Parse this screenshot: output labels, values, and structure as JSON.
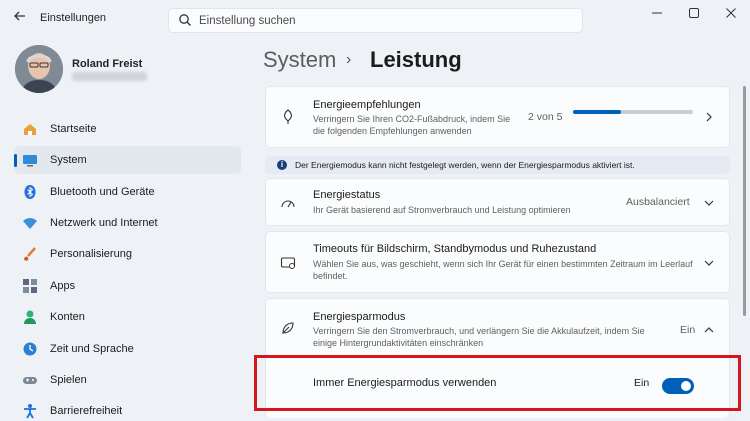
{
  "window": {
    "title": "Einstellungen"
  },
  "search": {
    "placeholder": "Einstellung suchen"
  },
  "profile": {
    "name": "Roland Freist"
  },
  "sidebar": {
    "items": [
      {
        "label": "Startseite",
        "icon": "home-icon",
        "active": false
      },
      {
        "label": "System",
        "icon": "system-monitor-icon",
        "active": true
      },
      {
        "label": "Bluetooth und Geräte",
        "icon": "bluetooth-icon",
        "active": false
      },
      {
        "label": "Netzwerk und Internet",
        "icon": "wifi-icon",
        "active": false
      },
      {
        "label": "Personalisierung",
        "icon": "brush-icon",
        "active": false
      },
      {
        "label": "Apps",
        "icon": "apps-icon",
        "active": false
      },
      {
        "label": "Konten",
        "icon": "account-icon",
        "active": false
      },
      {
        "label": "Zeit und Sprache",
        "icon": "clock-globe-icon",
        "active": false
      },
      {
        "label": "Spielen",
        "icon": "gamepad-icon",
        "active": false
      },
      {
        "label": "Barrierefreiheit",
        "icon": "accessibility-icon",
        "active": false
      }
    ]
  },
  "breadcrumb": {
    "parent": "System",
    "separator": "›",
    "current": "Leistung"
  },
  "energy_recommendations": {
    "title": "Energieempfehlungen",
    "description": "Verringern Sie Ihren CO2-Fußabdruck, indem Sie die folgenden Empfehlungen anwenden",
    "progress_text": "2 von 5",
    "progress_fraction": 0.4
  },
  "info": {
    "text": "Der Energiemodus kann nicht festgelegt werden, wenn der Energiesparmodus aktiviert ist."
  },
  "energy_status": {
    "title": "Energiestatus",
    "description": "Ihr Gerät basierend auf Stromverbrauch und Leistung optimieren",
    "value": "Ausbalanciert"
  },
  "timeouts": {
    "title": "Timeouts für Bildschirm, Standbymodus und Ruhezustand",
    "description": "Wählen Sie aus, was geschieht, wenn sich Ihr Gerät für einen bestimmten Zeitraum im Leerlauf befindet."
  },
  "energy_saver": {
    "title": "Energiesparmodus",
    "description": "Verringern Sie den Stromverbrauch, und verlängern Sie die Akkulaufzeit, indem Sie einige Hintergrundaktivitäten einschränken",
    "value": "Ein"
  },
  "always_saver": {
    "label": "Immer Energiesparmodus verwenden",
    "state_text": "Ein",
    "enabled": true
  },
  "colors": {
    "accent": "#005fb8",
    "highlight": "#d4171e"
  }
}
